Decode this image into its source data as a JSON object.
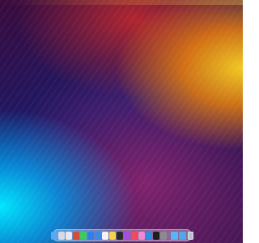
{
  "desktop": {
    "wallpaper_colors": {
      "top_right": "#ffb000",
      "top_center": "#c0282c",
      "center": "#1b1a6a",
      "bottom_left": "#00d8ff"
    }
  },
  "dock": {
    "apps": [
      {
        "name": "finder-icon",
        "color": "#5aa9f0"
      },
      {
        "name": "launchpad-icon",
        "color": "#d9d9e8"
      },
      {
        "name": "safari-icon",
        "color": "#e8e8f0"
      },
      {
        "name": "chrome-icon",
        "color": "#d84a3a"
      },
      {
        "name": "messages-icon",
        "color": "#3ccb5c"
      },
      {
        "name": "app-store-icon",
        "color": "#2f7ff0"
      },
      {
        "name": "xcode-icon",
        "color": "#3f88e8"
      },
      {
        "name": "calendar-icon",
        "color": "#f4f4f4"
      },
      {
        "name": "notes-icon",
        "color": "#f6d44a"
      },
      {
        "name": "clapper-icon",
        "color": "#2a2a2a"
      },
      {
        "name": "podcasts-icon",
        "color": "#a64ee0"
      },
      {
        "name": "music-icon",
        "color": "#f04a5e"
      },
      {
        "name": "photos-icon",
        "color": "#f08ad0"
      },
      {
        "name": "vscode-icon",
        "color": "#2d8fe0"
      },
      {
        "name": "terminal-icon",
        "color": "#1e1e1e"
      },
      {
        "name": "system-settings-icon",
        "color": "#8a8a92"
      }
    ],
    "folders": [
      {
        "name": "downloads-folder-icon",
        "color": "#59b5f5"
      },
      {
        "name": "documents-folder-icon",
        "color": "#4ea8ee"
      }
    ],
    "trash": {
      "name": "trash-icon",
      "color": "#b8c0cc"
    }
  }
}
